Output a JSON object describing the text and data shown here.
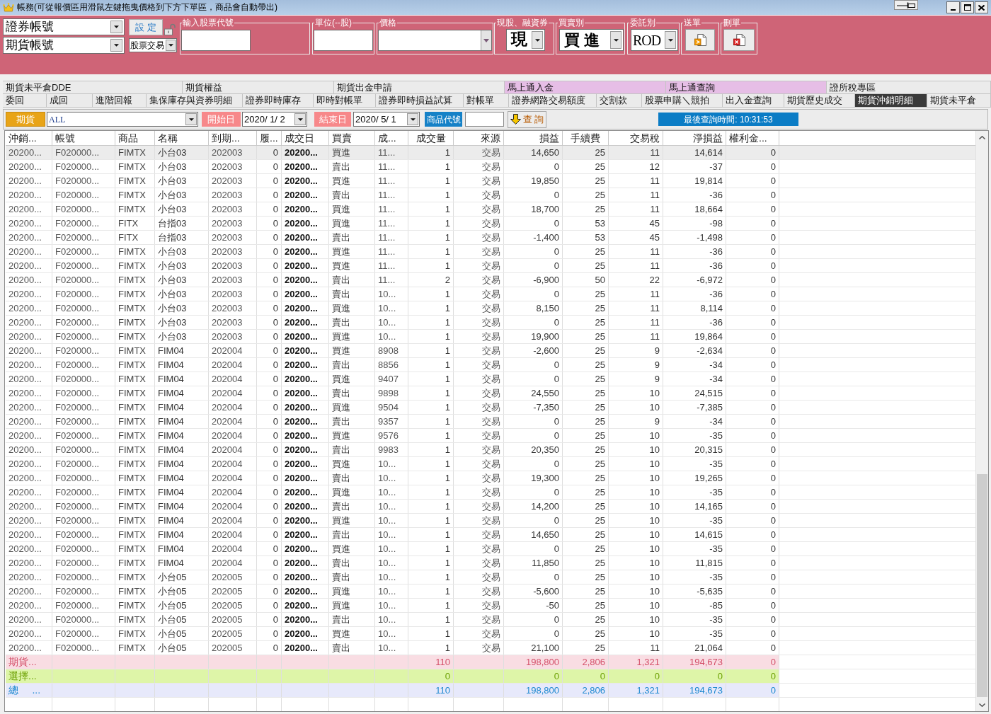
{
  "window": {
    "title": "帳務(可從報價區用滑鼠左鍵拖曳價格到下方下單區，商品會自動帶出)"
  },
  "order_panel": {
    "securities_account": "證券帳號",
    "futures_account": "期貨帳號",
    "settings_button": "設 定",
    "trade_type": "股票交易",
    "stock_code": {
      "label": "輸入股票代號"
    },
    "unit": {
      "label": "單位(--股)"
    },
    "price": {
      "label": "價格"
    },
    "position_type": {
      "label": "現股、融資券",
      "value": "現"
    },
    "side": {
      "label": "買賣別",
      "value": "買 進"
    },
    "order_type": {
      "label": "委託別",
      "value": "ROD"
    },
    "send": {
      "label": "送單"
    },
    "cancel": {
      "label": "刪單"
    }
  },
  "tabs_row_1": [
    {
      "label": "期貨未平倉DDE",
      "selected": false,
      "color": "#ebebeb"
    },
    {
      "label": "期貨權益",
      "selected": false,
      "color": "#ebebeb"
    },
    {
      "label": "期貨出金申請",
      "selected": false,
      "color": "#ebebeb"
    },
    {
      "label": "馬上通入金",
      "selected": false,
      "color": "#e6bee6"
    },
    {
      "label": "馬上通查詢",
      "selected": false,
      "color": "#e6bee6"
    },
    {
      "label": "證所稅專區",
      "selected": false,
      "color": "#ebebeb"
    }
  ],
  "tabs_row_2": [
    {
      "label": "委回",
      "selected": false
    },
    {
      "label": "成回",
      "selected": false
    },
    {
      "label": "進階回報",
      "selected": false
    },
    {
      "label": "集保庫存與資券明細",
      "selected": false
    },
    {
      "label": "證券即時庫存",
      "selected": false
    },
    {
      "label": "即時對帳單",
      "selected": false
    },
    {
      "label": "證券即時損益試算",
      "selected": false
    },
    {
      "label": "對帳單",
      "selected": false
    },
    {
      "label": "證券網路交易額度",
      "selected": false
    },
    {
      "label": "交割款",
      "selected": false
    },
    {
      "label": "股票申購＼競拍",
      "selected": false
    },
    {
      "label": "出入金查詢",
      "selected": false
    },
    {
      "label": "期貨歷史成交",
      "selected": false
    },
    {
      "label": "期貨沖銷明細",
      "selected": true
    },
    {
      "label": "期貨未平倉",
      "selected": false
    }
  ],
  "filter_bar": {
    "market": "期貨",
    "symbol": "ALL",
    "start_label": "開始日",
    "start_date": "2020/ 1/ 2",
    "end_label": "結束日",
    "end_date": "2020/ 5/ 1",
    "product_label": "商品代號",
    "query_button": "查 詢",
    "last_query": "最後查詢時間: 10:31:53"
  },
  "table": {
    "columns": [
      "沖銷...",
      "帳號",
      "商品",
      "名稱",
      "到期...",
      "履...",
      "成交日",
      "買賣",
      "成...",
      "成交量",
      "來源",
      "損益",
      "手續費",
      "交易稅",
      "淨損益",
      "權利金..."
    ],
    "rows": [
      {
        "selected": true,
        "cells": [
          "20200...",
          "F020000...",
          "FIMTX",
          "小台03",
          "202003",
          "0",
          "20200...",
          "買進",
          "11...",
          "1",
          "交易",
          "14,650",
          "25",
          "11",
          "14,614",
          "0"
        ]
      },
      {
        "selected": false,
        "cells": [
          "20200...",
          "F020000...",
          "FIMTX",
          "小台03",
          "202003",
          "0",
          "20200...",
          "賣出",
          "11...",
          "1",
          "交易",
          "0",
          "25",
          "12",
          "-37",
          "0"
        ]
      },
      {
        "selected": false,
        "cells": [
          "20200...",
          "F020000...",
          "FIMTX",
          "小台03",
          "202003",
          "0",
          "20200...",
          "買進",
          "11...",
          "1",
          "交易",
          "19,850",
          "25",
          "11",
          "19,814",
          "0"
        ]
      },
      {
        "selected": false,
        "cells": [
          "20200...",
          "F020000...",
          "FIMTX",
          "小台03",
          "202003",
          "0",
          "20200...",
          "賣出",
          "11...",
          "1",
          "交易",
          "0",
          "25",
          "11",
          "-36",
          "0"
        ]
      },
      {
        "selected": false,
        "cells": [
          "20200...",
          "F020000...",
          "FIMTX",
          "小台03",
          "202003",
          "0",
          "20200...",
          "買進",
          "11...",
          "1",
          "交易",
          "18,700",
          "25",
          "11",
          "18,664",
          "0"
        ]
      },
      {
        "selected": false,
        "cells": [
          "20200...",
          "F020000...",
          "FITX",
          "台指03",
          "202003",
          "0",
          "20200...",
          "買進",
          "11...",
          "1",
          "交易",
          "0",
          "53",
          "45",
          "-98",
          "0"
        ]
      },
      {
        "selected": false,
        "cells": [
          "20200...",
          "F020000...",
          "FITX",
          "台指03",
          "202003",
          "0",
          "20200...",
          "賣出",
          "11...",
          "1",
          "交易",
          "-1,400",
          "53",
          "45",
          "-1,498",
          "0"
        ]
      },
      {
        "selected": false,
        "cells": [
          "20200...",
          "F020000...",
          "FIMTX",
          "小台03",
          "202003",
          "0",
          "20200...",
          "買進",
          "11...",
          "1",
          "交易",
          "0",
          "25",
          "11",
          "-36",
          "0"
        ]
      },
      {
        "selected": false,
        "cells": [
          "20200...",
          "F020000...",
          "FIMTX",
          "小台03",
          "202003",
          "0",
          "20200...",
          "買進",
          "11...",
          "1",
          "交易",
          "0",
          "25",
          "11",
          "-36",
          "0"
        ]
      },
      {
        "selected": false,
        "cells": [
          "20200...",
          "F020000...",
          "FIMTX",
          "小台03",
          "202003",
          "0",
          "20200...",
          "賣出",
          "11...",
          "2",
          "交易",
          "-6,900",
          "50",
          "22",
          "-6,972",
          "0"
        ]
      },
      {
        "selected": false,
        "cells": [
          "20200...",
          "F020000...",
          "FIMTX",
          "小台03",
          "202003",
          "0",
          "20200...",
          "賣出",
          "10...",
          "1",
          "交易",
          "0",
          "25",
          "11",
          "-36",
          "0"
        ]
      },
      {
        "selected": false,
        "cells": [
          "20200...",
          "F020000...",
          "FIMTX",
          "小台03",
          "202003",
          "0",
          "20200...",
          "買進",
          "10...",
          "1",
          "交易",
          "8,150",
          "25",
          "11",
          "8,114",
          "0"
        ]
      },
      {
        "selected": false,
        "cells": [
          "20200...",
          "F020000...",
          "FIMTX",
          "小台03",
          "202003",
          "0",
          "20200...",
          "賣出",
          "10...",
          "1",
          "交易",
          "0",
          "25",
          "11",
          "-36",
          "0"
        ]
      },
      {
        "selected": false,
        "cells": [
          "20200...",
          "F020000...",
          "FIMTX",
          "小台03",
          "202003",
          "0",
          "20200...",
          "買進",
          "10...",
          "1",
          "交易",
          "19,900",
          "25",
          "11",
          "19,864",
          "0"
        ]
      },
      {
        "selected": false,
        "cells": [
          "20200...",
          "F020000...",
          "FIMTX",
          "FIM04",
          "202004",
          "0",
          "20200...",
          "買進",
          "8908",
          "1",
          "交易",
          "-2,600",
          "25",
          "9",
          "-2,634",
          "0"
        ]
      },
      {
        "selected": false,
        "cells": [
          "20200...",
          "F020000...",
          "FIMTX",
          "FIM04",
          "202004",
          "0",
          "20200...",
          "賣出",
          "8856",
          "1",
          "交易",
          "0",
          "25",
          "9",
          "-34",
          "0"
        ]
      },
      {
        "selected": false,
        "cells": [
          "20200...",
          "F020000...",
          "FIMTX",
          "FIM04",
          "202004",
          "0",
          "20200...",
          "買進",
          "9407",
          "1",
          "交易",
          "0",
          "25",
          "9",
          "-34",
          "0"
        ]
      },
      {
        "selected": false,
        "cells": [
          "20200...",
          "F020000...",
          "FIMTX",
          "FIM04",
          "202004",
          "0",
          "20200...",
          "賣出",
          "9898",
          "1",
          "交易",
          "24,550",
          "25",
          "10",
          "24,515",
          "0"
        ]
      },
      {
        "selected": false,
        "cells": [
          "20200...",
          "F020000...",
          "FIMTX",
          "FIM04",
          "202004",
          "0",
          "20200...",
          "買進",
          "9504",
          "1",
          "交易",
          "-7,350",
          "25",
          "10",
          "-7,385",
          "0"
        ]
      },
      {
        "selected": false,
        "cells": [
          "20200...",
          "F020000...",
          "FIMTX",
          "FIM04",
          "202004",
          "0",
          "20200...",
          "賣出",
          "9357",
          "1",
          "交易",
          "0",
          "25",
          "9",
          "-34",
          "0"
        ]
      },
      {
        "selected": false,
        "cells": [
          "20200...",
          "F020000...",
          "FIMTX",
          "FIM04",
          "202004",
          "0",
          "20200...",
          "買進",
          "9576",
          "1",
          "交易",
          "0",
          "25",
          "10",
          "-35",
          "0"
        ]
      },
      {
        "selected": false,
        "cells": [
          "20200...",
          "F020000...",
          "FIMTX",
          "FIM04",
          "202004",
          "0",
          "20200...",
          "賣出",
          "9983",
          "1",
          "交易",
          "20,350",
          "25",
          "10",
          "20,315",
          "0"
        ]
      },
      {
        "selected": false,
        "cells": [
          "20200...",
          "F020000...",
          "FIMTX",
          "FIM04",
          "202004",
          "0",
          "20200...",
          "買進",
          "10...",
          "1",
          "交易",
          "0",
          "25",
          "10",
          "-35",
          "0"
        ]
      },
      {
        "selected": false,
        "cells": [
          "20200...",
          "F020000...",
          "FIMTX",
          "FIM04",
          "202004",
          "0",
          "20200...",
          "賣出",
          "10...",
          "1",
          "交易",
          "19,300",
          "25",
          "10",
          "19,265",
          "0"
        ]
      },
      {
        "selected": false,
        "cells": [
          "20200...",
          "F020000...",
          "FIMTX",
          "FIM04",
          "202004",
          "0",
          "20200...",
          "買進",
          "10...",
          "1",
          "交易",
          "0",
          "25",
          "10",
          "-35",
          "0"
        ]
      },
      {
        "selected": false,
        "cells": [
          "20200...",
          "F020000...",
          "FIMTX",
          "FIM04",
          "202004",
          "0",
          "20200...",
          "賣出",
          "10...",
          "1",
          "交易",
          "14,200",
          "25",
          "10",
          "14,165",
          "0"
        ]
      },
      {
        "selected": false,
        "cells": [
          "20200...",
          "F020000...",
          "FIMTX",
          "FIM04",
          "202004",
          "0",
          "20200...",
          "買進",
          "10...",
          "1",
          "交易",
          "0",
          "25",
          "10",
          "-35",
          "0"
        ]
      },
      {
        "selected": false,
        "cells": [
          "20200...",
          "F020000...",
          "FIMTX",
          "FIM04",
          "202004",
          "0",
          "20200...",
          "賣出",
          "10...",
          "1",
          "交易",
          "14,650",
          "25",
          "10",
          "14,615",
          "0"
        ]
      },
      {
        "selected": false,
        "cells": [
          "20200...",
          "F020000...",
          "FIMTX",
          "FIM04",
          "202004",
          "0",
          "20200...",
          "買進",
          "10...",
          "1",
          "交易",
          "0",
          "25",
          "10",
          "-35",
          "0"
        ]
      },
      {
        "selected": false,
        "cells": [
          "20200...",
          "F020000...",
          "FIMTX",
          "FIM04",
          "202004",
          "0",
          "20200...",
          "賣出",
          "10...",
          "1",
          "交易",
          "11,850",
          "25",
          "10",
          "11,815",
          "0"
        ]
      },
      {
        "selected": false,
        "cells": [
          "20200...",
          "F020000...",
          "FIMTX",
          "小台05",
          "202005",
          "0",
          "20200...",
          "賣出",
          "10...",
          "1",
          "交易",
          "0",
          "25",
          "10",
          "-35",
          "0"
        ]
      },
      {
        "selected": false,
        "cells": [
          "20200...",
          "F020000...",
          "FIMTX",
          "小台05",
          "202005",
          "0",
          "20200...",
          "買進",
          "10...",
          "1",
          "交易",
          "-5,600",
          "25",
          "10",
          "-5,635",
          "0"
        ]
      },
      {
        "selected": false,
        "cells": [
          "20200...",
          "F020000...",
          "FIMTX",
          "小台05",
          "202005",
          "0",
          "20200...",
          "買進",
          "10...",
          "1",
          "交易",
          "-50",
          "25",
          "10",
          "-85",
          "0"
        ]
      },
      {
        "selected": false,
        "cells": [
          "20200...",
          "F020000...",
          "FIMTX",
          "小台05",
          "202005",
          "0",
          "20200...",
          "賣出",
          "10...",
          "1",
          "交易",
          "0",
          "25",
          "10",
          "-35",
          "0"
        ]
      },
      {
        "selected": false,
        "cells": [
          "20200...",
          "F020000...",
          "FIMTX",
          "小台05",
          "202005",
          "0",
          "20200...",
          "買進",
          "10...",
          "1",
          "交易",
          "0",
          "25",
          "10",
          "-35",
          "0"
        ]
      },
      {
        "selected": false,
        "cells": [
          "20200...",
          "F020000...",
          "FIMTX",
          "小台05",
          "202005",
          "0",
          "20200...",
          "賣出",
          "10...",
          "1",
          "交易",
          "21,100",
          "25",
          "11",
          "21,064",
          "0"
        ]
      }
    ],
    "summary": [
      {
        "kind": "futures",
        "label": "期貨...",
        "volume": "110",
        "profit": "198,800",
        "fee": "2,806",
        "tax": "1,321",
        "net_profit": "194,673",
        "premium": "0"
      },
      {
        "kind": "options",
        "label": "選擇...",
        "volume": "0",
        "profit": "0",
        "fee": "0",
        "tax": "0",
        "net_profit": "0",
        "premium": "0"
      },
      {
        "kind": "total",
        "label": "總     ...",
        "volume": "110",
        "profit": "198,800",
        "fee": "2,806",
        "tax": "1,321",
        "net_profit": "194,673",
        "premium": "0"
      }
    ]
  }
}
